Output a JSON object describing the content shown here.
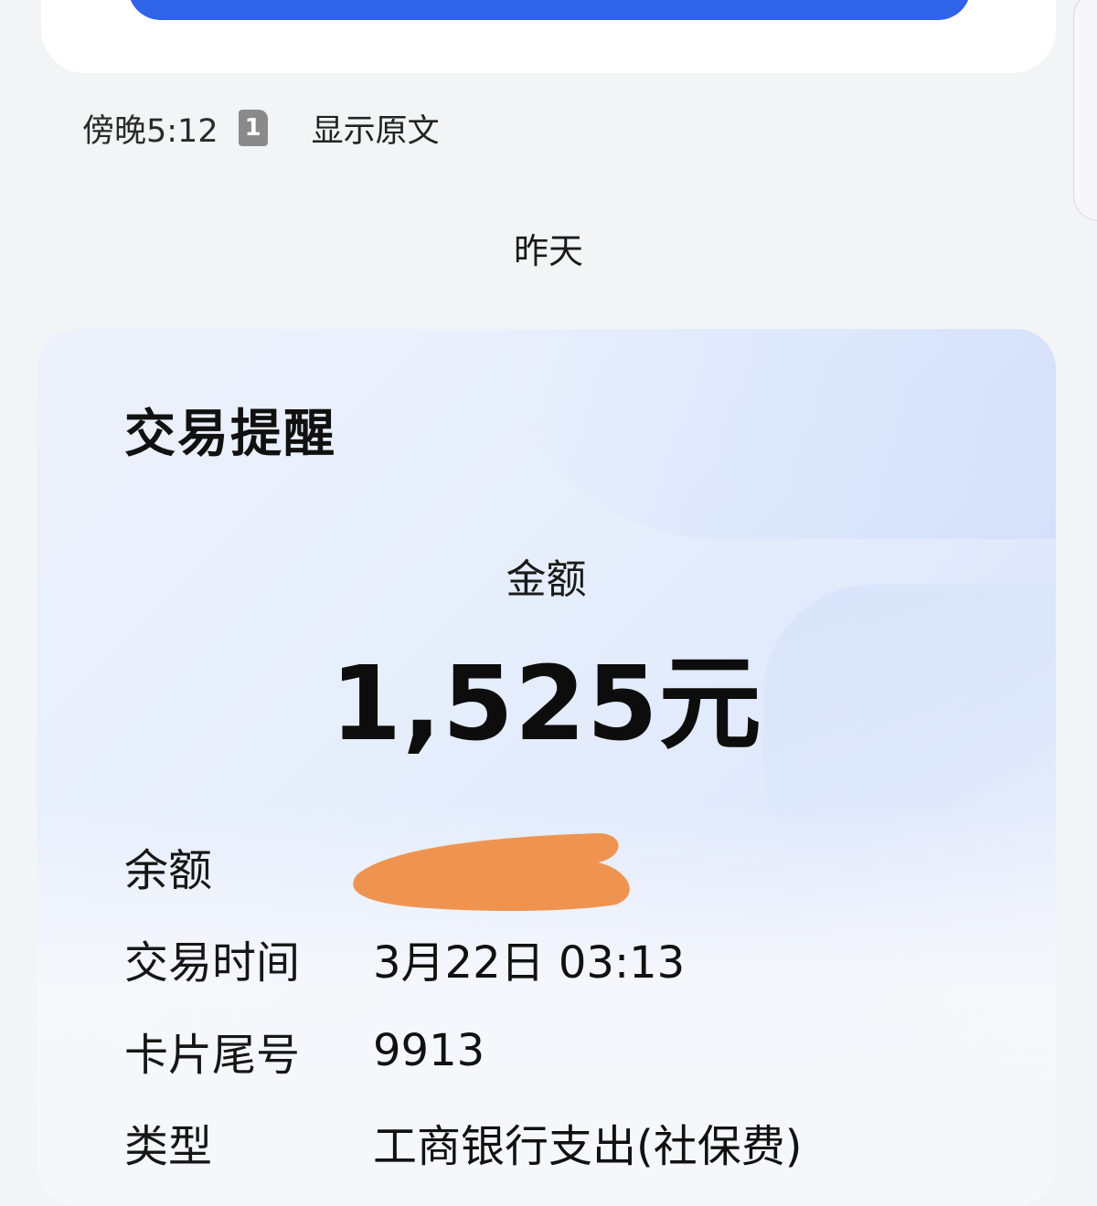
{
  "header": {
    "time": "傍晚5:12",
    "sim_slot": "1",
    "show_original_label": "显示原文"
  },
  "date_separator": "昨天",
  "message_card": {
    "title": "交易提醒",
    "amount_label": "金额",
    "amount_value": "1,525元",
    "fields": [
      {
        "label": "余额",
        "value": ""
      },
      {
        "label": "交易时间",
        "value": "3月22日 03:13"
      },
      {
        "label": "卡片尾号",
        "value": "9913"
      },
      {
        "label": "类型",
        "value": "工商银行支出(社保费)"
      }
    ],
    "redaction_color": "#ef9450"
  },
  "colors": {
    "top_button": "#2f63e8",
    "background": "#f3f4f6"
  }
}
